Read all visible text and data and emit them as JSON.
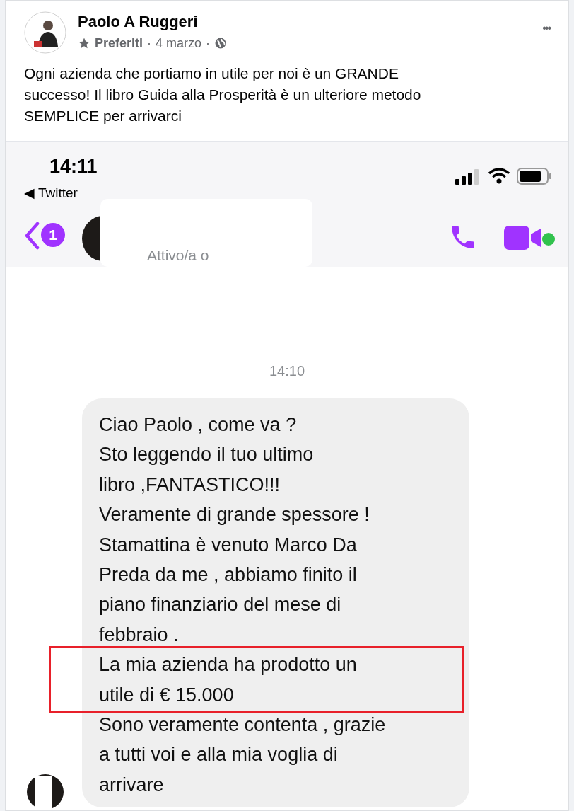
{
  "post": {
    "author": "Paolo A Ruggeri",
    "audience": "Preferiti",
    "separator_1": "·",
    "date": "4 marzo",
    "separator_2": "·",
    "more": "•••",
    "text_lines": [
      "Ogni azienda che portiamo in utile per noi è un GRANDE",
      "successo! Il libro Guida alla Prosperità è un ulteriore metodo",
      "SEMPLICE per arrivarci"
    ]
  },
  "phone": {
    "time": "14:11",
    "back_app": "◀ Twitter",
    "unread_badge": "1",
    "contact_status": "Attivo/a o",
    "online": true,
    "chat_time": "14:10",
    "message_blocks": [
      {
        "kind": "plain",
        "lines": [
          "Ciao Paolo , come va ?",
          "Sto leggendo il tuo ultimo",
          "libro ,FANTASTICO!!!",
          "Veramente di grande spessore !",
          "Stamattina è venuto Marco Da",
          "Preda da me , abbiamo finito il",
          "piano finanziario del mese di",
          "febbraio ."
        ]
      },
      {
        "kind": "highlighted",
        "lines": [
          "La mia azienda ha prodotto un",
          "utile di € 15.000"
        ]
      },
      {
        "kind": "plain",
        "lines": [
          "Sono veramente contenta , grazie",
          "a tutti voi e alla mia voglia di",
          "arrivare"
        ]
      }
    ]
  }
}
